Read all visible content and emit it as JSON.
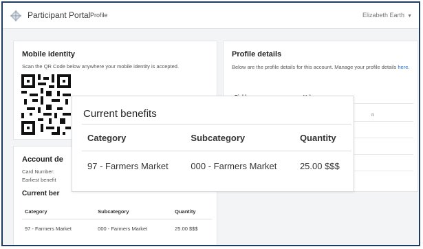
{
  "navbar": {
    "brand": "Participant Portal",
    "profile_link": "Profile",
    "user_name": "Elizabeth Earth",
    "caret": "▼"
  },
  "mobile_identity": {
    "title": "Mobile identity",
    "description": "Scan the QR Code below anywhere your mobile identity is accepted."
  },
  "profile_details": {
    "title": "Profile details",
    "description": "Below are the profile details for this account. Manage your profile details ",
    "link_text": "here.",
    "columns": [
      "Field",
      "Value"
    ],
    "partial_value": "n"
  },
  "account_details": {
    "title": "Account de",
    "card_number_label": "Card Number:",
    "earliest_label": "Earliest benefit",
    "current_benefits_title": "Current ber",
    "table": {
      "headers": [
        "Category",
        "Subcategory",
        "Quantity"
      ],
      "rows": [
        [
          "97 - Farmers Market",
          "000 - Farmers Market",
          "25.00 $$$"
        ]
      ]
    }
  },
  "current_benefits_popup": {
    "title": "Current benefits",
    "headers": [
      "Category",
      "Subcategory",
      "Quantity"
    ],
    "rows": [
      [
        "97 - Farmers Market",
        "000 - Farmers Market",
        "25.00 $$$"
      ]
    ]
  },
  "colors": {
    "frame_border": "#1f3a5f",
    "link": "#1f6fd1",
    "background": "#f3f4f6"
  }
}
